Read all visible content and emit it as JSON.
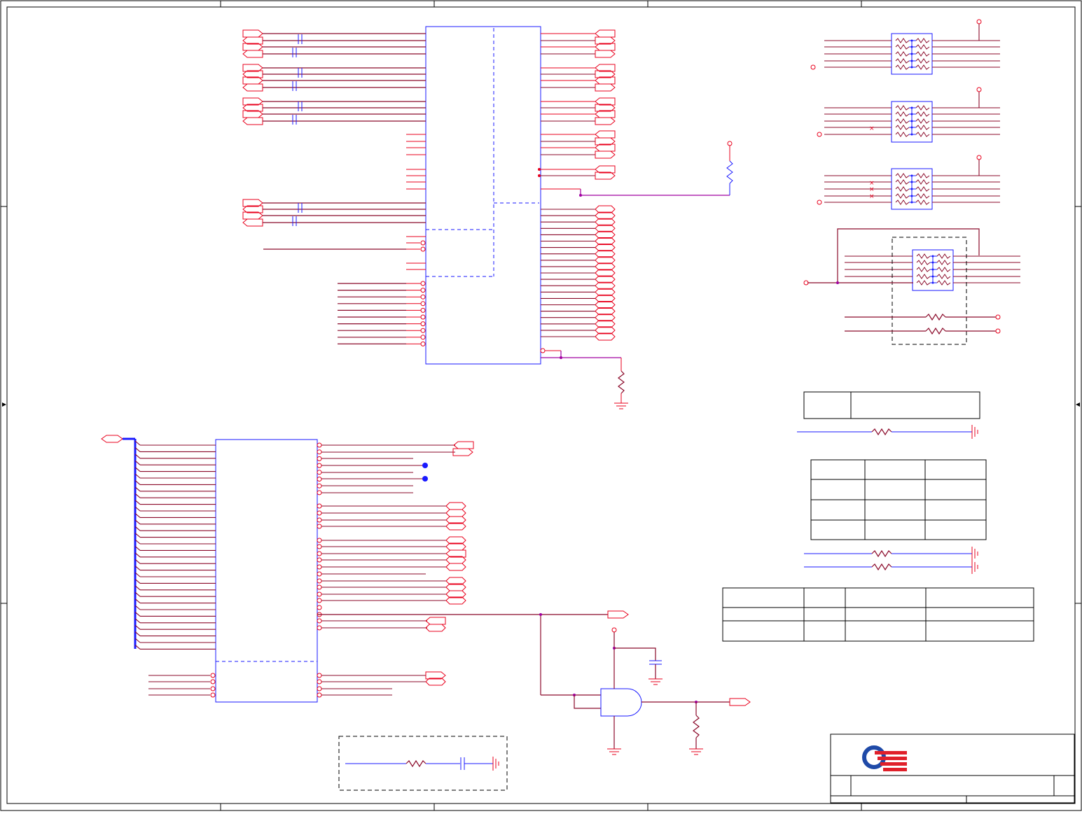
{
  "sheet": {
    "title_block": {
      "logo": "logo-icon",
      "logo_colors": {
        "ring": "#1f4aa8",
        "stripes": "#e0202a"
      }
    }
  },
  "colors": {
    "wire": "#8b0a2a",
    "component": "#1a1aff",
    "pin": "#e8001c",
    "junction": "#a000a0",
    "frame": "#000000"
  },
  "notes": {
    "text": ""
  }
}
